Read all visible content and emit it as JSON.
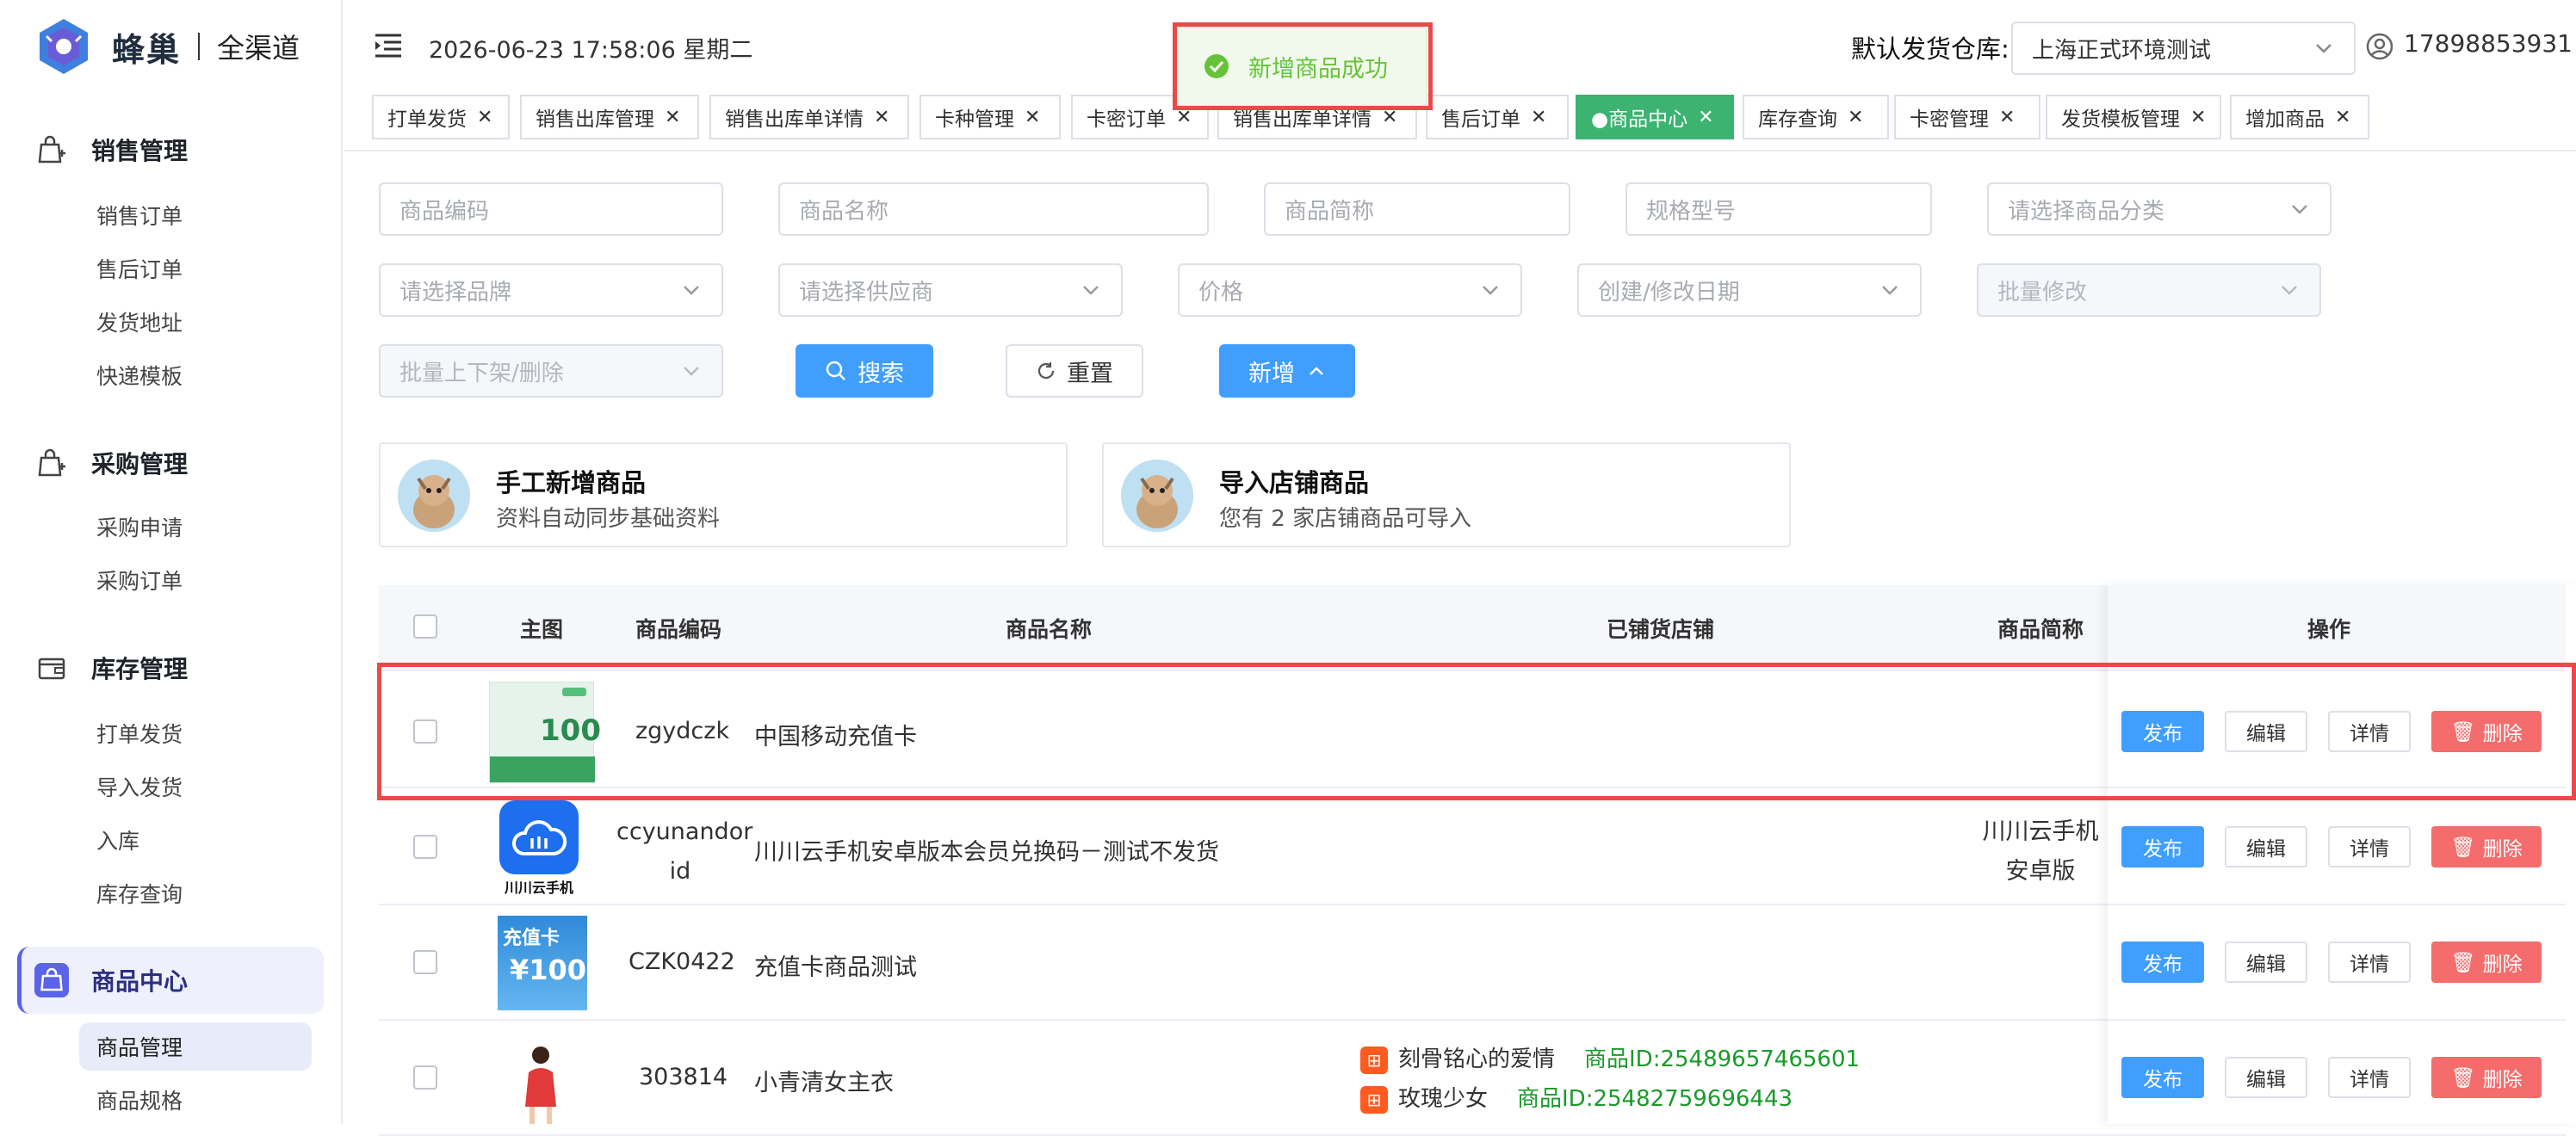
{
  "app": {
    "logo_name": "蜂巢",
    "logo_sub": "全渠道"
  },
  "header": {
    "datetime": "2026-06-23 17:58:06 星期二",
    "warehouse_label": "默认发货仓库:",
    "warehouse_value": "上海正式环境测试",
    "user": "17898853931"
  },
  "toast": {
    "message": "新增商品成功",
    "color": "#67c23a"
  },
  "sidebar": {
    "sections": [
      {
        "label": "销售管理",
        "items": [
          "销售订单",
          "售后订单",
          "发货地址",
          "快递模板"
        ]
      },
      {
        "label": "采购管理",
        "items": [
          "采购申请",
          "采购订单"
        ]
      },
      {
        "label": "库存管理",
        "items": [
          "打单发货",
          "导入发货",
          "入库",
          "库存查询"
        ]
      },
      {
        "label": "商品中心",
        "items": [
          "商品管理",
          "商品规格"
        ]
      }
    ],
    "active_section": "商品中心",
    "active_item": "商品管理",
    "accent": "#5b63e8"
  },
  "tabs": [
    {
      "label": "打单发货"
    },
    {
      "label": "销售出库管理"
    },
    {
      "label": "销售出库单详情"
    },
    {
      "label": "卡种管理"
    },
    {
      "label": "卡密订单"
    },
    {
      "label": "销售出库单详情"
    },
    {
      "label": "售后订单"
    },
    {
      "label": "●商品中心",
      "active": true
    },
    {
      "label": "库存查询"
    },
    {
      "label": "卡密管理"
    },
    {
      "label": "发货模板管理"
    },
    {
      "label": "增加商品"
    }
  ],
  "filters": {
    "code": "商品编码",
    "name": "商品名称",
    "short": "商品简称",
    "spec": "规格型号",
    "category": "请选择商品分类",
    "brand": "请选择品牌",
    "supplier": "请选择供应商",
    "price": "价格",
    "date": "创建/修改日期",
    "bulk_edit": "批量修改",
    "bulk_shelf": "批量上下架/删除",
    "search": "搜索",
    "reset": "重置",
    "add": "新增"
  },
  "cards": [
    {
      "title": "手工新增商品",
      "desc": "资料自动同步基础资料"
    },
    {
      "title": "导入店铺商品",
      "desc": "您有 2 家店铺商品可导入"
    }
  ],
  "table": {
    "headers": {
      "image": "主图",
      "code": "商品编码",
      "name": "商品名称",
      "shops": "已铺货店铺",
      "short": "商品简称",
      "ops": "操作"
    },
    "actions": {
      "publish": "发布",
      "edit": "编辑",
      "detail": "详情",
      "delete": "删除"
    },
    "rows": [
      {
        "code": "zgydczk",
        "name": "中国移动充值卡",
        "short": "",
        "image": "china-mobile-card",
        "image_text": "100"
      },
      {
        "code_l1": "ccyunandor",
        "code_l2": "id",
        "name": "川川云手机安卓版本会员兑换码－测试不发货",
        "short_l1": "川川云手机",
        "short_l2": "安卓版",
        "image": "cloud-phone-logo",
        "image_text": "川川云手机"
      },
      {
        "code": "CZK0422",
        "name": "充值卡商品测试",
        "short": "",
        "image": "recharge-card",
        "image_text_1": "充值卡",
        "image_text_2": "¥100"
      },
      {
        "code": "303814",
        "name": "小青清女主衣",
        "short": "",
        "image": "woman-clothing-photo",
        "shops": [
          {
            "shop": "刻骨铭心的爱情",
            "id": "商品ID:25489657465601"
          },
          {
            "shop": "玫瑰少女",
            "id": "商品ID:25482759696443"
          }
        ]
      }
    ]
  }
}
